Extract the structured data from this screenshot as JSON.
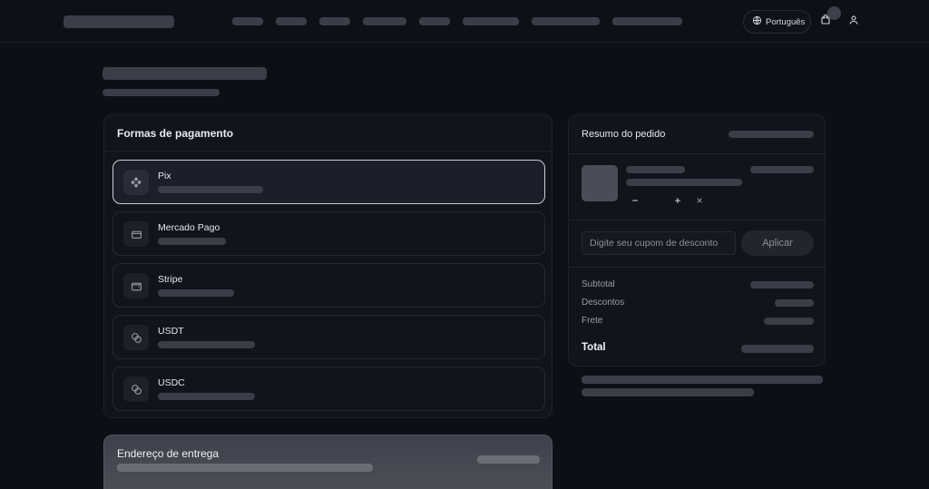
{
  "header": {
    "language_label": "Português",
    "icons": {
      "language": "globe-icon",
      "cart": "shopping-bag-icon",
      "account": "user-icon"
    }
  },
  "payment": {
    "title": "Formas de pagamento",
    "methods": [
      {
        "name": "Pix",
        "icon": "pix-icon",
        "selected": true
      },
      {
        "name": "Mercado Pago",
        "icon": "card-icon",
        "selected": false
      },
      {
        "name": "Stripe",
        "icon": "wallet-icon",
        "selected": false
      },
      {
        "name": "USDT",
        "icon": "coins-icon",
        "selected": false
      },
      {
        "name": "USDC",
        "icon": "coins-icon",
        "selected": false
      }
    ]
  },
  "address": {
    "title": "Endereço de entrega"
  },
  "summary": {
    "title": "Resumo do pedido",
    "item_controls": {
      "decrease": "−",
      "increase": "+",
      "remove": "×"
    },
    "coupon_placeholder": "Digite seu cupom de desconto",
    "apply_label": "Aplicar",
    "subtotal_label": "Subtotal",
    "discounts_label": "Descontos",
    "shipping_label": "Frete",
    "total_label": "Total"
  },
  "colors": {
    "background": "#0d0f17",
    "card": "#12141c",
    "skeleton": "#3b3e48",
    "selected_border": "#c9ccd4"
  }
}
